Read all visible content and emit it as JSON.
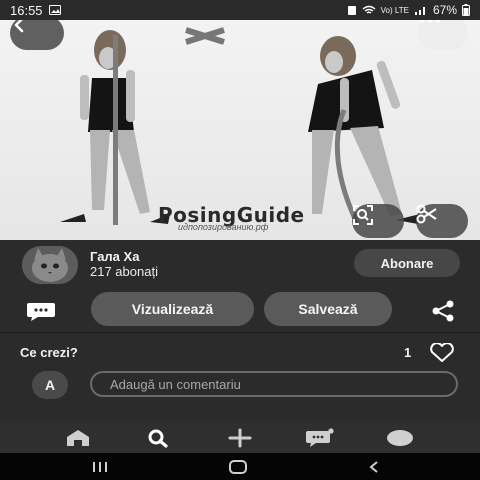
{
  "status_bar": {
    "time": "16:55",
    "network": "Vo) LTE",
    "battery": "67%"
  },
  "image": {
    "watermark": "PosingGuide",
    "watermark_sub": "идпопозированию.рф"
  },
  "creator": {
    "name": "Гала Ха",
    "followers": "217 abonați",
    "follow_label": "Abonare"
  },
  "actions": {
    "visit_label": "Vizualizează",
    "save_label": "Salvează"
  },
  "comments": {
    "title": "Ce crezi?",
    "likes": "1",
    "user_initial": "A",
    "placeholder": "Adaugă un comentariu"
  },
  "icons": {
    "back": "chevron-left-icon",
    "more": "ellipsis-icon",
    "lens": "visual-search-icon",
    "scissors": "scissors-icon",
    "comment": "speech-bubble-icon",
    "share": "share-icon",
    "heart": "heart-icon",
    "home": "home-icon",
    "search": "search-icon",
    "create": "plus-icon",
    "messages": "chat-icon",
    "profile": "profile-icon"
  },
  "colors": {
    "background": "#2b2b2b",
    "pill": "#5a5a5a",
    "nav": "#2f2f2f",
    "system_nav": "#050505"
  }
}
